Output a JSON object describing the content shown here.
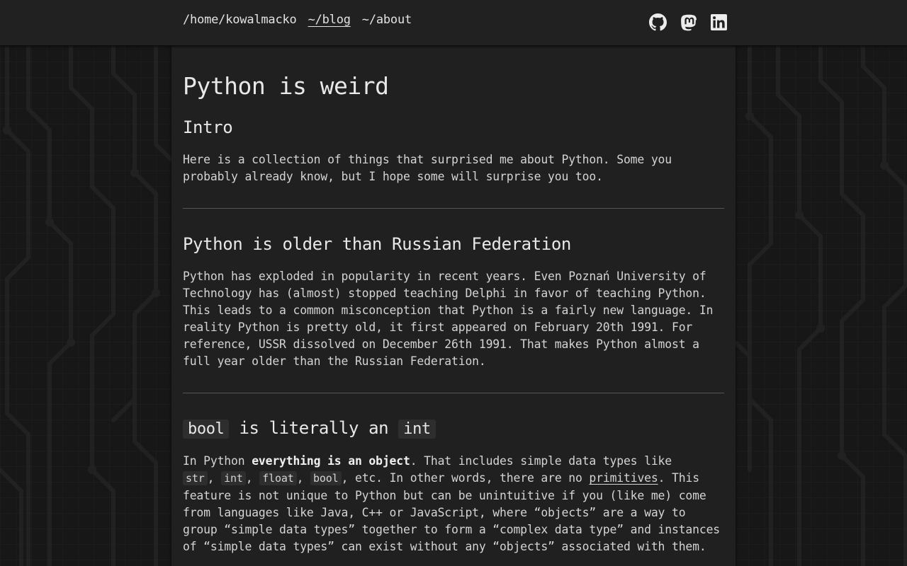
{
  "nav": {
    "home": "/home/kowalmacko",
    "blog": "~/blog",
    "about": "~/about"
  },
  "social": {
    "github": "github-icon",
    "mastodon": "mastodon-icon",
    "linkedin": "linkedin-icon"
  },
  "article": {
    "title": "Python is weird",
    "sections": [
      {
        "heading": "Intro",
        "body": "Here is a collection of things that surprised me about Python. Some you probably already know, but I hope some will surprise you too."
      },
      {
        "heading": "Python is older than Russian Federation",
        "body": "Python has exploded in popularity in recent years. Even Poznań University of Technology has (almost) stopped teaching Delphi in favor of teaching Python. This leads to a common misconception that Python is a fairly new language. In reality Python is pretty old, it first appeared on February 20th 1991. For reference, USSR dissolved on December 26th 1991. That makes Python almost a full year older than the Russian Federation."
      },
      {
        "heading_code_1": "bool",
        "heading_mid": " is literally an ",
        "heading_code_2": "int",
        "body_prefix": "In Python ",
        "body_bold": "everything is an object",
        "body_after_bold": ". That includes simple data types like",
        "types": [
          "str",
          "int",
          "float",
          "bool"
        ],
        "sep": ",",
        "body_after_types": ", etc. In other words, there are no ",
        "link": "primitives",
        "body_rest": ". This feature is not unique to Python but can be unintuitive if you (like me) come from languages like Java, C++ or JavaScript, where “objects” are a way to group “simple data types” together to form a “complex data type” and instances of “simple data types” can exist without any “objects” associated with them."
      }
    ]
  },
  "colors": {
    "page_bg": "#171717",
    "header_bg": "#212121",
    "content_bg": "#202020",
    "text": "#d4d4d4",
    "code_bg": "#2e2e2e"
  }
}
